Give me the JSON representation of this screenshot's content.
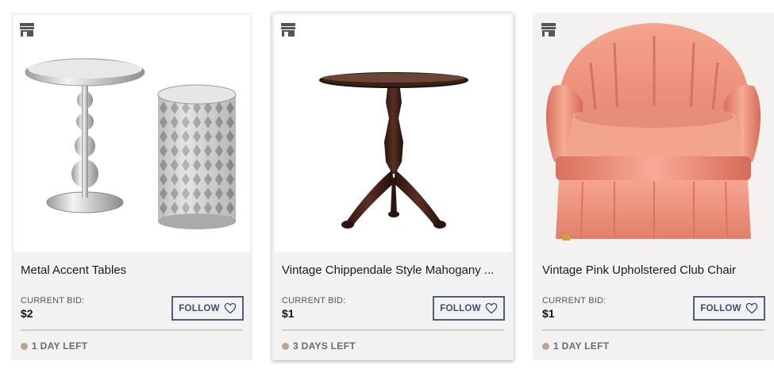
{
  "cards": [
    {
      "title": "Metal Accent Tables",
      "bid_label": "CURRENT BID:",
      "bid_value": "$2",
      "follow_label": "FOLLOW",
      "time_left": "1 DAY LEFT",
      "image": "metal-accent-tables"
    },
    {
      "title": "Vintage Chippendale Style Mahogany ...",
      "bid_label": "CURRENT BID:",
      "bid_value": "$1",
      "follow_label": "FOLLOW",
      "time_left": "3 DAYS LEFT",
      "image": "mahogany-tilt-top-table"
    },
    {
      "title": "Vintage Pink Upholstered Club Chair",
      "bid_label": "CURRENT BID:",
      "bid_value": "$1",
      "follow_label": "FOLLOW",
      "time_left": "1 DAY LEFT",
      "image": "pink-club-chair"
    }
  ],
  "icons": {
    "store": "store-icon",
    "heart": "heart-icon"
  },
  "colors": {
    "card_bg": "#f2f2f2",
    "follow_border": "#4e5f7c",
    "status_dot": "#b7a594",
    "text": "#1a1a1a"
  }
}
